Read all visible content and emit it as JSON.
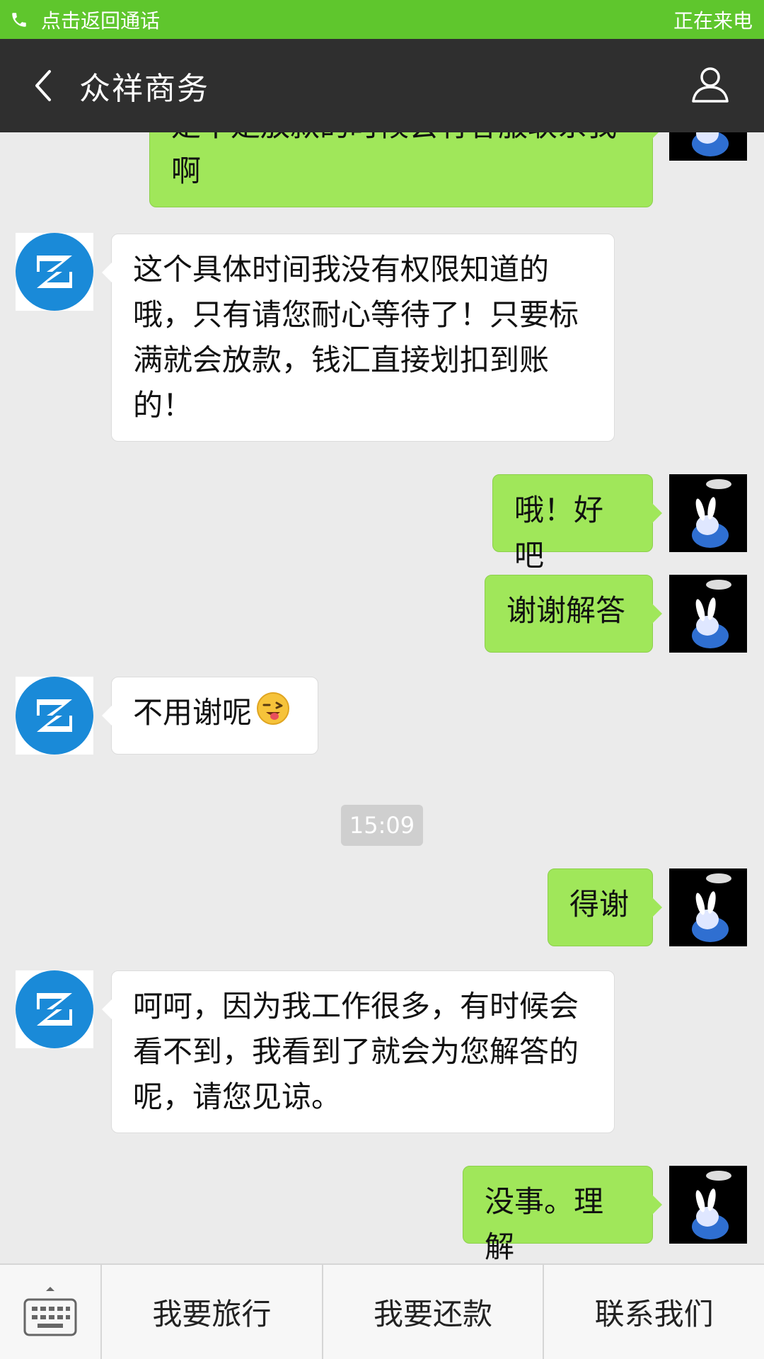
{
  "call_bar": {
    "return_label": "点击返回通话",
    "status_label": "正在来电",
    "color": "#5fc62d"
  },
  "header": {
    "title": "众祥商务"
  },
  "messages": [
    {
      "from": "user",
      "text": "是不是放款的时候会有客服联系我啊"
    },
    {
      "from": "agent",
      "text": "这个具体时间我没有权限知道的哦，只有请您耐心等待了！只要标满就会放款，钱汇直接划扣到账的！"
    },
    {
      "from": "user",
      "text": "哦！好吧"
    },
    {
      "from": "user",
      "text": "谢谢解答"
    },
    {
      "from": "agent",
      "text": "不用谢呢",
      "emoji": "winking-face-tongue"
    },
    {
      "from": "user",
      "text": "得谢"
    },
    {
      "from": "agent",
      "text": "呵呵，因为我工作很多，有时候会看不到，我看到了就会为您解答的呢，请您见谅。"
    },
    {
      "from": "user",
      "text": "没事。理解"
    }
  ],
  "timestamp": "15:09",
  "bottom_menu": {
    "items": [
      "我要旅行",
      "我要还款",
      "联系我们"
    ]
  },
  "colors": {
    "user_bubble": "#a0e75a",
    "agent_bubble": "#ffffff",
    "header": "#2f2f2f",
    "chat_background": "#ebebeb",
    "agent_logo": "#1a8ad8"
  }
}
